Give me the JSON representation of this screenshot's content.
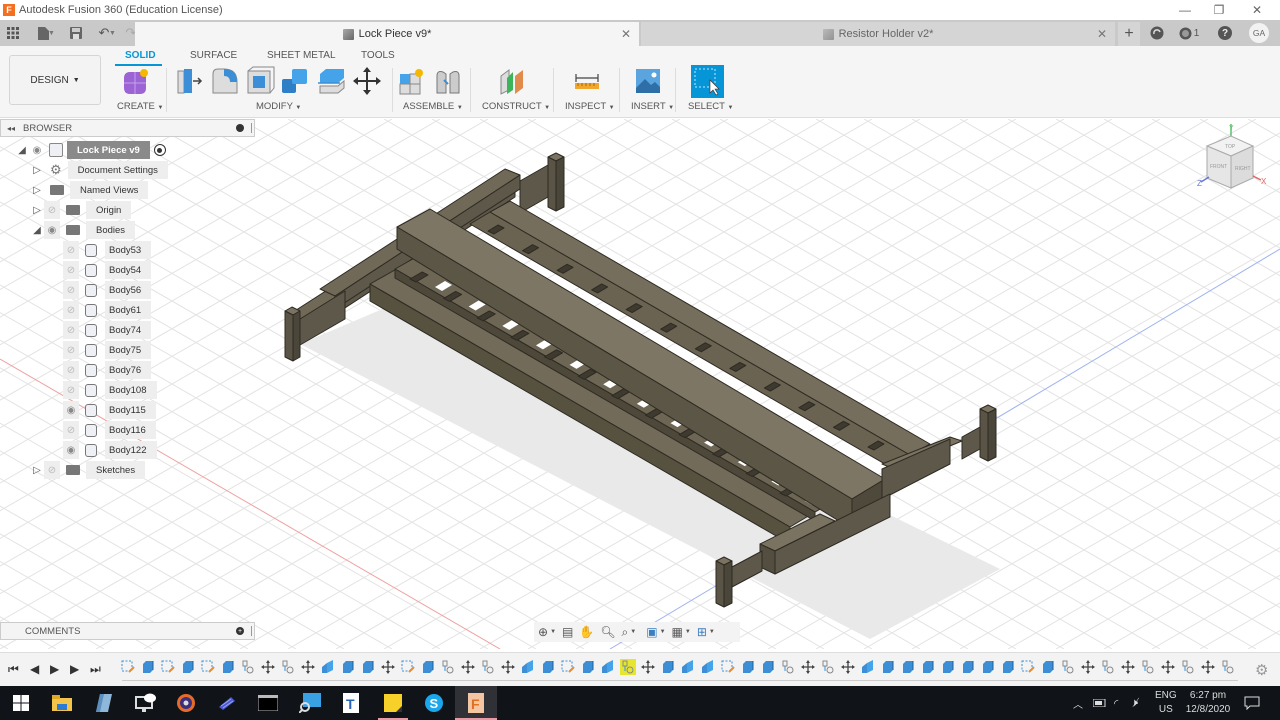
{
  "window": {
    "title": "Autodesk Fusion 360 (Education License)",
    "app_logo": "F",
    "controls": {
      "minimize": "—",
      "restore": "❐",
      "close": "✕"
    }
  },
  "quick_access": {
    "icons": [
      "apps-grid-icon",
      "file-icon",
      "save-icon",
      "undo-icon",
      "redo-icon"
    ]
  },
  "tabs": [
    {
      "label": "Lock Piece v9*",
      "active": true
    },
    {
      "label": "Resistor Holder v2*",
      "active": false
    }
  ],
  "tab_right": {
    "new_tab": "+",
    "job_status_icon": "refresh-icon",
    "notifications_count": "1",
    "help": "?",
    "user_initials": "GA"
  },
  "ribbon": {
    "workspace": "DESIGN",
    "tabs": [
      "SOLID",
      "SURFACE",
      "SHEET METAL",
      "TOOLS"
    ],
    "active_tab": "SOLID",
    "groups": [
      {
        "label": "CREATE",
        "tools": [
          "create-form-icon"
        ]
      },
      {
        "label": "MODIFY",
        "tools": [
          "press-pull-icon",
          "fillet-icon",
          "shell-icon",
          "combine-icon",
          "replace-face-icon",
          "move-icon"
        ]
      },
      {
        "label": "ASSEMBLE",
        "tools": [
          "new-component-icon",
          "joint-icon"
        ]
      },
      {
        "label": "CONSTRUCT",
        "tools": [
          "plane-icon"
        ]
      },
      {
        "label": "INSPECT",
        "tools": [
          "measure-icon"
        ]
      },
      {
        "label": "INSERT",
        "tools": [
          "insert-image-icon"
        ]
      },
      {
        "label": "SELECT",
        "tools": [
          "select-icon"
        ]
      }
    ],
    "accent": "#0696d7"
  },
  "browser": {
    "title": "BROWSER",
    "root": "Lock Piece v9",
    "items": [
      {
        "label": "Document Settings",
        "type": "settings",
        "expanded": false
      },
      {
        "label": "Named Views",
        "type": "folder",
        "expanded": false
      },
      {
        "label": "Origin",
        "type": "folder",
        "expanded": false,
        "visible": false
      },
      {
        "label": "Bodies",
        "type": "folder",
        "expanded": true,
        "visible": true
      }
    ],
    "bodies": [
      {
        "label": "Body53",
        "visible": false
      },
      {
        "label": "Body54",
        "visible": false
      },
      {
        "label": "Body56",
        "visible": false
      },
      {
        "label": "Body61",
        "visible": false
      },
      {
        "label": "Body74",
        "visible": false
      },
      {
        "label": "Body75",
        "visible": false
      },
      {
        "label": "Body76",
        "visible": false
      },
      {
        "label": "Body108",
        "visible": false
      },
      {
        "label": "Body115",
        "visible": true
      },
      {
        "label": "Body116",
        "visible": false
      },
      {
        "label": "Body122",
        "visible": true
      }
    ],
    "sketches": {
      "label": "Sketches",
      "visible": false
    }
  },
  "viewcube": {
    "top": "TOP",
    "front": "FRONT",
    "right": "RIGHT",
    "axes": {
      "x": "X",
      "y": "Y",
      "z": "Z"
    }
  },
  "comments": {
    "title": "COMMENTS"
  },
  "nav_bar": {
    "icons": [
      "orbit-icon",
      "look-at-icon",
      "pan-icon",
      "zoom-icon",
      "fit-icon",
      "display-settings-icon",
      "grid-icon",
      "viewports-icon"
    ]
  },
  "timeline": {
    "controls": [
      "go-to-start",
      "step-back",
      "play",
      "step-forward",
      "go-to-end"
    ],
    "items": [
      "sketch",
      "extrude",
      "sketch",
      "extrude",
      "sketch",
      "extrude",
      "joint",
      "move",
      "joint",
      "move",
      "combine",
      "extrude",
      "extrude",
      "move",
      "sketch",
      "extrude",
      "joint",
      "move",
      "joint",
      "move",
      "combine",
      "extrude",
      "sketch",
      "extrude",
      "combine",
      "joint",
      "move",
      "extrude",
      "combine",
      "combine",
      "sketch",
      "extrude",
      "extrude",
      "joint",
      "move",
      "joint",
      "move",
      "combine",
      "extrude",
      "extrude",
      "extrude",
      "extrude",
      "extrude",
      "extrude",
      "extrude",
      "sketch",
      "extrude",
      "joint",
      "move",
      "joint",
      "move",
      "joint",
      "move",
      "joint",
      "move",
      "joint"
    ],
    "highlighted_index": 25,
    "settings_icon": "gear-icon"
  },
  "taskbar": {
    "apps": [
      "windows-start-icon",
      "file-explorer-icon",
      "notepad-icon",
      "remote-desktop-icon",
      "media-player-icon",
      "app-icon",
      "terminal-icon",
      "search-screen-icon",
      "typora-icon",
      "sticky-notes-icon",
      "skype-icon",
      "fusion-360-icon"
    ],
    "tray": {
      "language": "ENG",
      "region": "US",
      "time": "6:27 pm",
      "date": "12/8/2020"
    }
  }
}
